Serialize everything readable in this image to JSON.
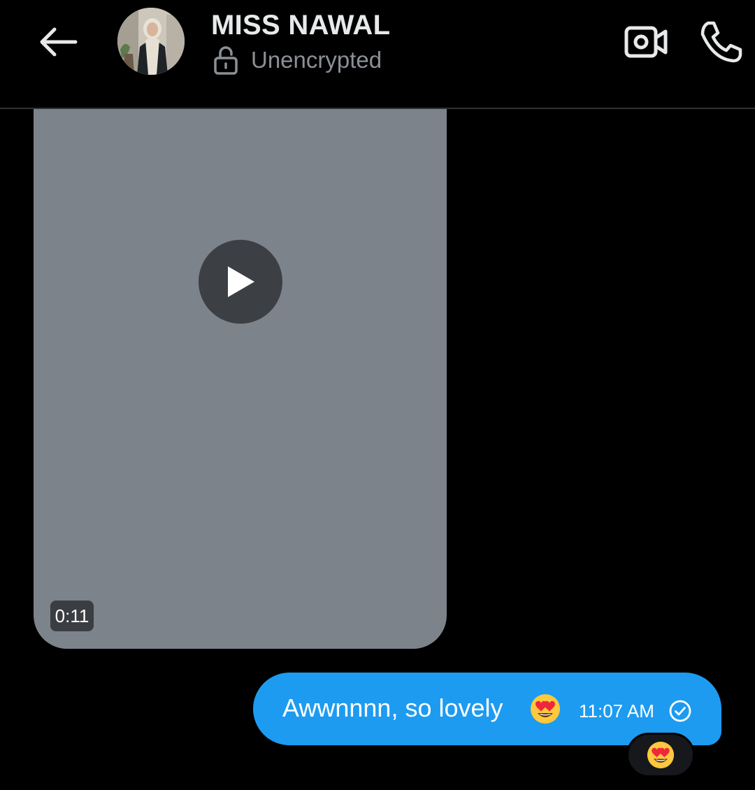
{
  "header": {
    "contact_name": "MISS NAWAL",
    "encryption_status": "Unencrypted",
    "icons": {
      "back": "arrow-left-icon",
      "lock": "unlocked-icon",
      "video_call": "video-camera-icon",
      "voice_call": "phone-icon"
    }
  },
  "messages": [
    {
      "type": "video",
      "direction": "received",
      "duration": "0:11",
      "icon": "play-icon"
    },
    {
      "type": "text",
      "direction": "sent",
      "text": "Awwnnnn, so lovely",
      "emoji": "heart-eyes-emoji",
      "time": "11:07 AM",
      "status_icon": "sent-check-icon",
      "reaction": "heart-eyes-emoji"
    }
  ],
  "colors": {
    "background": "#000000",
    "sent_bubble": "#1d9bf0",
    "video_placeholder": "#7d838b",
    "muted_text": "#8b9096"
  }
}
